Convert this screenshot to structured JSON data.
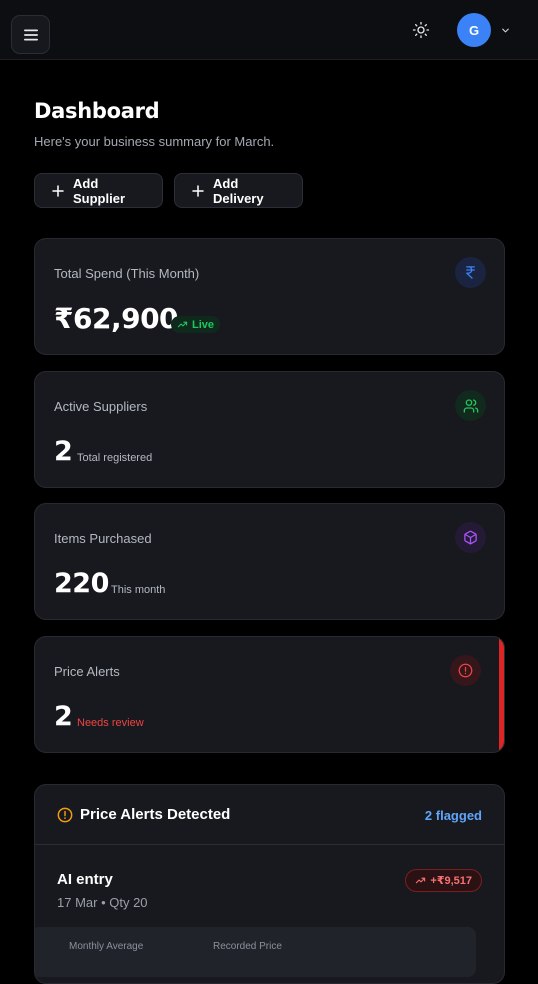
{
  "topbar": {
    "menu_icon": "hamburger-icon",
    "theme_icon": "sun-icon",
    "avatar_initial": "G",
    "avatar_color": "#3b82f6",
    "chevron_icon": "chevron-down-icon"
  },
  "header": {
    "title": "Dashboard",
    "subtitle": "Here's your business summary for March."
  },
  "actions": {
    "add_supplier": "Add Supplier",
    "add_delivery": "Add Delivery"
  },
  "cards": {
    "spend": {
      "label": "Total Spend (This Month)",
      "value": "₹62,900",
      "badge": "Live",
      "icon": "rupee-icon",
      "accent": "#3b82f6"
    },
    "suppliers": {
      "label": "Active Suppliers",
      "value": "2",
      "caption": "Total registered",
      "icon": "users-icon",
      "accent": "#22c55e"
    },
    "items": {
      "label": "Items Purchased",
      "value": "220",
      "caption": "This month",
      "icon": "box-icon",
      "accent": "#a855f7"
    },
    "alerts": {
      "label": "Price Alerts",
      "value": "2",
      "caption": "Needs review",
      "icon": "alert-circle-icon",
      "accent": "#ef4444"
    }
  },
  "alerts_panel": {
    "title": "Price Alerts Detected",
    "flagged": "2 flagged",
    "entry": {
      "name": "AI entry",
      "meta": "17 Mar • Qty 20",
      "badge": "+₹9,517",
      "col1": "Monthly Average",
      "col2": "Recorded Price"
    }
  }
}
